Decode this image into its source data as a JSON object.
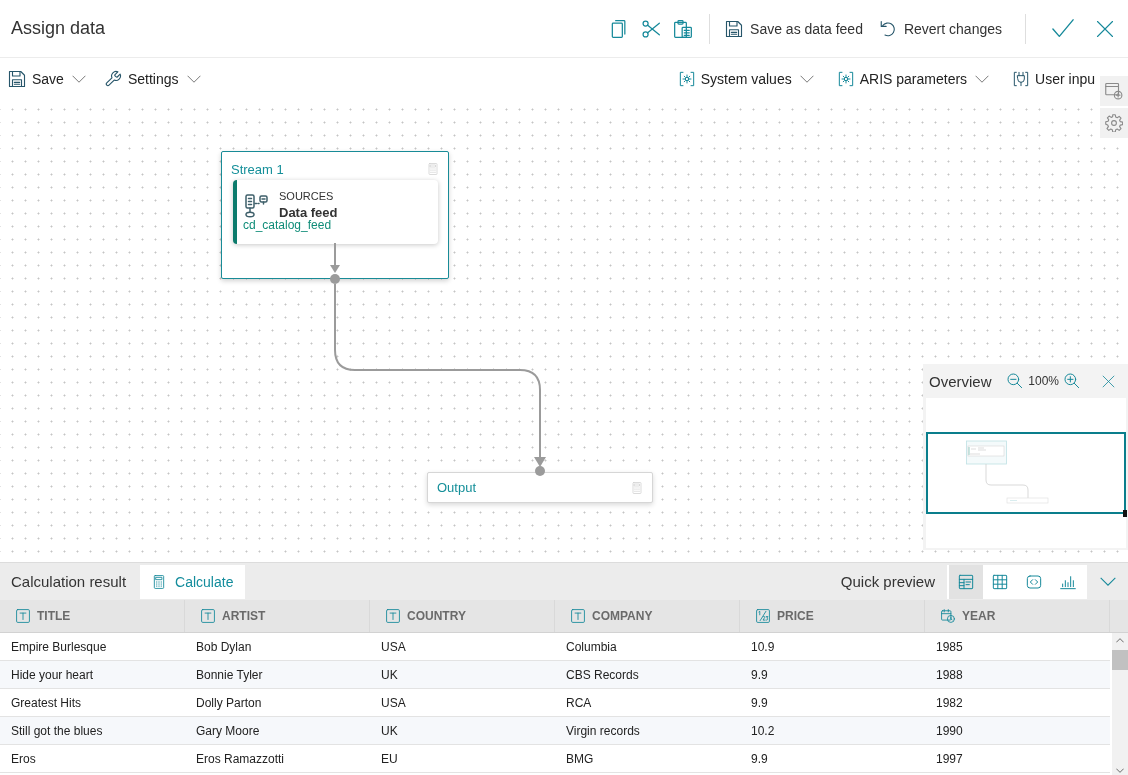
{
  "header": {
    "title": "Assign data",
    "buttons": [
      {
        "kind": "save",
        "label": "Save as data feed"
      },
      {
        "kind": "revert",
        "label": "Revert changes"
      }
    ]
  },
  "toolbar": {
    "left": [
      {
        "kind": "save",
        "label": "Save",
        "dropdown": true
      },
      {
        "kind": "settings",
        "label": "Settings",
        "dropdown": true
      }
    ],
    "right": [
      {
        "kind": "system",
        "label": "System values",
        "dropdown": true
      },
      {
        "kind": "parameters",
        "label": "ARIS parameters",
        "dropdown": true
      },
      {
        "kind": "input",
        "label": "User inpu",
        "dropdown": false
      }
    ]
  },
  "canvas": {
    "stream": {
      "title": "Stream 1",
      "step": {
        "category": "SOURCES",
        "title": "Data feed",
        "source": "cd_catalog_feed"
      }
    },
    "output": {
      "title": "Output"
    }
  },
  "overview": {
    "title": "Overview",
    "zoom": "100%"
  },
  "calculation": {
    "title": "Calculation result",
    "calculate": "Calculate",
    "preview_label": "Quick preview",
    "views": [
      {
        "kind": "form",
        "selected": true
      },
      {
        "kind": "table",
        "selected": false
      },
      {
        "kind": "code",
        "selected": false
      },
      {
        "kind": "chart",
        "selected": false
      }
    ]
  },
  "table": {
    "columns": [
      {
        "kind": "text",
        "label": "TITLE"
      },
      {
        "kind": "text",
        "label": "ARTIST"
      },
      {
        "kind": "text",
        "label": "COUNTRY"
      },
      {
        "kind": "text",
        "label": "COMPANY"
      },
      {
        "kind": "number",
        "label": "PRICE"
      },
      {
        "kind": "date",
        "label": "YEAR"
      }
    ],
    "rows": [
      [
        "Empire Burlesque",
        "Bob Dylan",
        "USA",
        "Columbia",
        "10.9",
        "1985"
      ],
      [
        "Hide your heart",
        "Bonnie Tyler",
        "UK",
        "CBS Records",
        "9.9",
        "1988"
      ],
      [
        "Greatest Hits",
        "Dolly Parton",
        "USA",
        "RCA",
        "9.9",
        "1982"
      ],
      [
        "Still got the blues",
        "Gary Moore",
        "UK",
        "Virgin records",
        "10.2",
        "1990"
      ],
      [
        "Eros",
        "Eros Ramazzotti",
        "EU",
        "BMG",
        "9.9",
        "1997"
      ]
    ]
  }
}
